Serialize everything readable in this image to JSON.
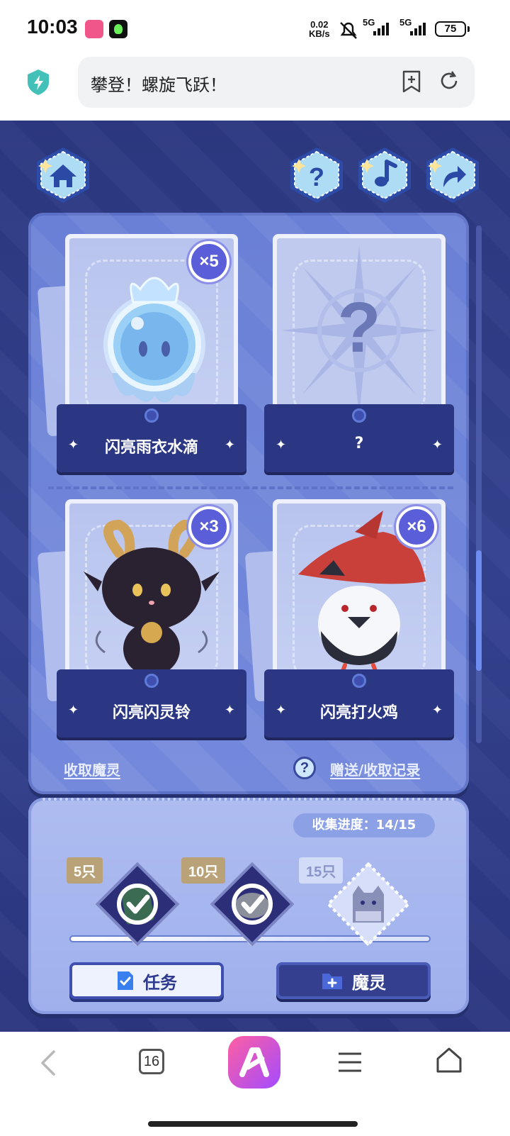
{
  "status_bar": {
    "time": "10:03",
    "net_speed_value": "0.02",
    "net_speed_unit": "KB/s",
    "signal_1": "5G",
    "signal_2": "5G",
    "battery": "75"
  },
  "browser": {
    "page_title": "攀登！螺旋飞跃！"
  },
  "game": {
    "top_buttons": [
      "home-icon",
      "help-icon",
      "music-icon",
      "share-icon"
    ],
    "cards": [
      {
        "name": "闪亮雨衣水滴",
        "count": "×5",
        "revealed": true
      },
      {
        "name": "?",
        "count": "",
        "revealed": false
      },
      {
        "name": "闪亮闪灵铃",
        "count": "×3",
        "revealed": true
      },
      {
        "name": "闪亮打火鸡",
        "count": "×6",
        "revealed": true
      }
    ],
    "collect_link": "收取魔灵",
    "record_link": "赠送/收取记录",
    "help_mark": "?"
  },
  "progress": {
    "label": "收集进度：",
    "value": "14/15",
    "current": 14,
    "total": 15,
    "milestones": [
      {
        "tag": "5只",
        "done": true
      },
      {
        "tag": "10只",
        "done": true
      },
      {
        "tag": "15只",
        "done": false
      }
    ],
    "task_button": "任务",
    "spirit_button": "魔灵"
  },
  "bottom_nav": {
    "tab_count": "16"
  },
  "colors": {
    "game_bg": "#2f3b86",
    "panel": "#7185da",
    "badge": "#5a5ed8"
  }
}
